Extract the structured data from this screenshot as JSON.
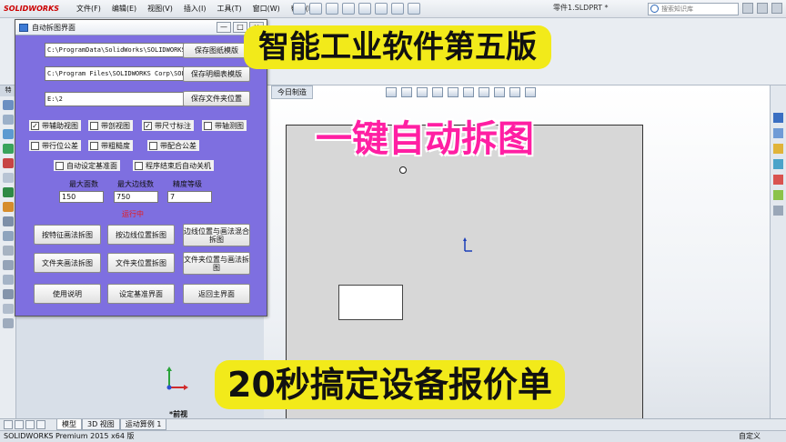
{
  "app": {
    "logo": "SOLIDWORKS",
    "menus": [
      "文件(F)",
      "编辑(E)",
      "视图(V)",
      "插入(I)",
      "工具(T)",
      "窗口(W)",
      "帮助(H)"
    ],
    "document_title": "零件1.SLDPRT *",
    "search_placeholder": "搜索知识库"
  },
  "left_panel": {
    "feature_tab": "特"
  },
  "viewport": {
    "today_tab": "今日制造",
    "view_name": "*前视"
  },
  "bottom_tabs": [
    "模型",
    "3D 视图",
    "运动算例 1"
  ],
  "status": {
    "left": "SOLIDWORKS Premium 2015 x64 版",
    "right": "自定义"
  },
  "dialog": {
    "title": "自动拆图界面",
    "controls": [
      "—",
      "□",
      "×"
    ],
    "paths": [
      {
        "value": "C:\\ProgramData\\SolidWorks\\SOLIDWORKS",
        "button": "保存图纸模版"
      },
      {
        "value": "C:\\Program Files\\SOLIDWORKS Corp\\SOL",
        "button": "保存明细表模版"
      },
      {
        "value": "E:\\2",
        "button": "保存文件夹位置"
      }
    ],
    "checkboxes": [
      {
        "label": "带辅助视图",
        "checked": true
      },
      {
        "label": "带剖视图",
        "checked": false
      },
      {
        "label": "带尺寸标注",
        "checked": true
      },
      {
        "label": "带轴测图",
        "checked": false
      },
      {
        "label": "带行位公差",
        "checked": false
      },
      {
        "label": "带粗糙度",
        "checked": false
      },
      {
        "label": "带配合公差",
        "checked": false
      },
      {
        "label": "自动设定基准面",
        "checked": false
      },
      {
        "label": "程序结束后自动关机",
        "checked": false
      }
    ],
    "params": [
      {
        "label": "最大面数",
        "value": "150"
      },
      {
        "label": "最大边线数",
        "value": "750"
      },
      {
        "label": "精度等级",
        "value": "7"
      }
    ],
    "status_text": "运行中",
    "buttons": [
      "按特征画法拆图",
      "按边线位置拆图",
      "边线位置与画法混合拆图",
      "文件夹画法拆图",
      "文件夹位置拆图",
      "文件夹位置与画法拆图",
      "使用说明",
      "设定基准界面",
      "返回主界面"
    ]
  },
  "overlay": {
    "headline": "智能工业软件第五版",
    "sub_headline": "一键自动拆图",
    "bottom_caption": "20秒搞定设备报价单"
  },
  "colors": {
    "dialog_bg": "#7e6fe0",
    "caption_bg": "#f2ea1a",
    "sub_headline": "#ff1fa3",
    "running_text": "#e81a1a"
  }
}
